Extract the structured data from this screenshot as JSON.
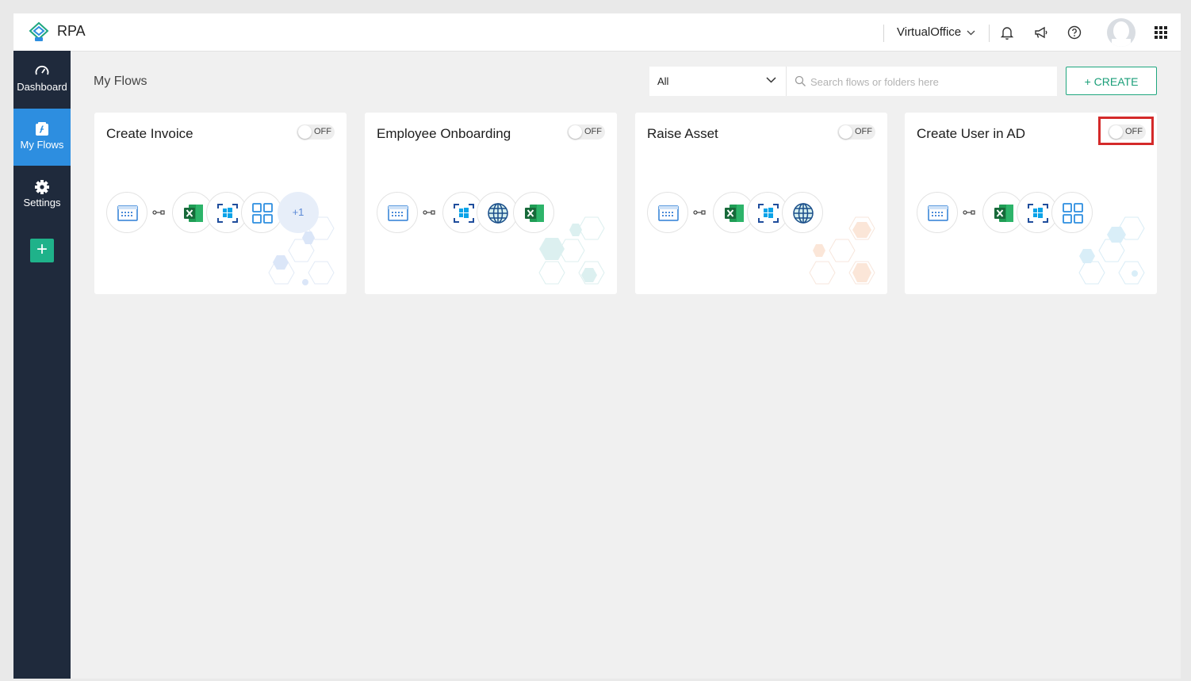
{
  "app": {
    "title": "RPA",
    "organization": "VirtualOffice"
  },
  "header_icons": [
    "bell-icon",
    "megaphone-icon",
    "help-icon",
    "avatar",
    "app-grid-icon"
  ],
  "sidebar": {
    "items": [
      {
        "label": "Dashboard",
        "icon": "dashboard-gauge-icon",
        "active": false
      },
      {
        "label": "My Flows",
        "icon": "flow-icon",
        "active": true
      },
      {
        "label": "Settings",
        "icon": "gear-icon",
        "active": false
      }
    ],
    "add_label": "+"
  },
  "main": {
    "title": "My Flows",
    "filter": {
      "selected": "All"
    },
    "search": {
      "placeholder": "Search flows or folders here",
      "value": ""
    },
    "create_label": "+ CREATE"
  },
  "flows": [
    {
      "name": "Create Invoice",
      "status": "OFF",
      "apps": [
        "scheduler-icon",
        "excel-icon",
        "windows-icon",
        "apps-grid-icon"
      ],
      "more": "+1",
      "deco_color": "#dbe6f8"
    },
    {
      "name": "Employee Onboarding",
      "status": "OFF",
      "apps": [
        "scheduler-icon",
        "windows-icon",
        "globe-icon",
        "excel-icon"
      ],
      "more": "",
      "deco_color": "#dcf0f0"
    },
    {
      "name": "Raise Asset",
      "status": "OFF",
      "apps": [
        "scheduler-icon",
        "excel-icon",
        "windows-icon",
        "globe-icon"
      ],
      "more": "",
      "deco_color": "#fbe6d8"
    },
    {
      "name": "Create User in AD",
      "status": "OFF",
      "apps": [
        "scheduler-icon",
        "excel-icon",
        "windows-icon",
        "apps-grid-icon"
      ],
      "more": "",
      "deco_color": "#d9eef8",
      "highlighted": true
    }
  ],
  "colors": {
    "sidebar": "#1f2a3c",
    "active": "#2d8ee0",
    "accent": "#1fa77f",
    "highlight": "#d42a2a"
  }
}
